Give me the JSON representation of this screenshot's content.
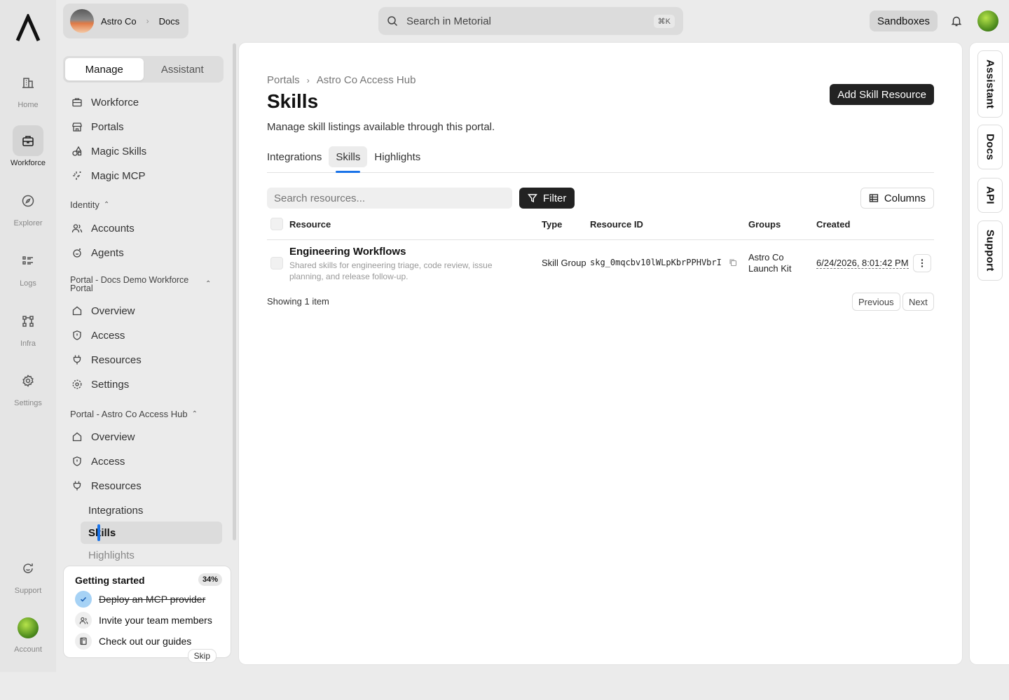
{
  "rail": {
    "items": [
      {
        "label": "Home",
        "icon": "building-icon"
      },
      {
        "label": "Workforce",
        "icon": "briefcase-icon"
      },
      {
        "label": "Explorer",
        "icon": "compass-icon"
      },
      {
        "label": "Logs",
        "icon": "list-icon"
      },
      {
        "label": "Infra",
        "icon": "nodes-icon"
      },
      {
        "label": "Settings",
        "icon": "gear-icon"
      },
      {
        "label": "Support",
        "icon": "chat-icon"
      },
      {
        "label": "Account",
        "icon": "avatar"
      }
    ]
  },
  "org": {
    "name": "Astro Co",
    "docs": "Docs"
  },
  "search": {
    "placeholder": "Search in Metorial",
    "shortcut": "⌘K"
  },
  "topbar": {
    "sandboxes": "Sandboxes"
  },
  "sidebar": {
    "segments": [
      "Manage",
      "Assistant"
    ],
    "top_items": [
      "Workforce",
      "Portals",
      "Magic Skills",
      "Magic MCP"
    ],
    "identity_label": "Identity",
    "identity_items": [
      "Accounts",
      "Agents"
    ],
    "portal1_label": "Portal - Docs Demo Workforce Portal",
    "portal1_items": [
      "Overview",
      "Access",
      "Resources",
      "Settings"
    ],
    "portal2_label": "Portal - Astro Co Access Hub",
    "portal2_items": [
      "Overview",
      "Access",
      "Resources"
    ],
    "portal2_sub": [
      "Integrations",
      "Skills",
      "Highlights"
    ]
  },
  "getting_started": {
    "title": "Getting started",
    "percent": "34%",
    "items": [
      "Deploy an MCP provider",
      "Invite your team members",
      "Check out our guides"
    ],
    "skip": "Skip"
  },
  "main": {
    "breadcrumb": [
      "Portals",
      "Astro Co Access Hub"
    ],
    "title": "Skills",
    "description": "Manage skill listings available through this portal.",
    "add_button": "Add Skill Resource",
    "tabs": [
      "Integrations",
      "Skills",
      "Highlights"
    ],
    "search_placeholder": "Search resources...",
    "filter": "Filter",
    "columns": "Columns",
    "headers": [
      "Resource",
      "Type",
      "Resource ID",
      "Groups",
      "Created"
    ],
    "rows": [
      {
        "name": "Engineering Workflows",
        "description": "Shared skills for engineering triage, code review, issue planning, and release follow-up.",
        "type": "Skill Group",
        "id": "skg_0mqcbv10lWLpKbrPPHVbrI",
        "group_line1": "Astro Co",
        "group_line2": "Launch Kit",
        "created": "6/24/2026, 8:01:42 PM"
      }
    ],
    "showing": "Showing 1 item",
    "prev": "Previous",
    "next": "Next"
  },
  "right_rail": [
    "Assistant",
    "Docs",
    "API",
    "Support"
  ]
}
